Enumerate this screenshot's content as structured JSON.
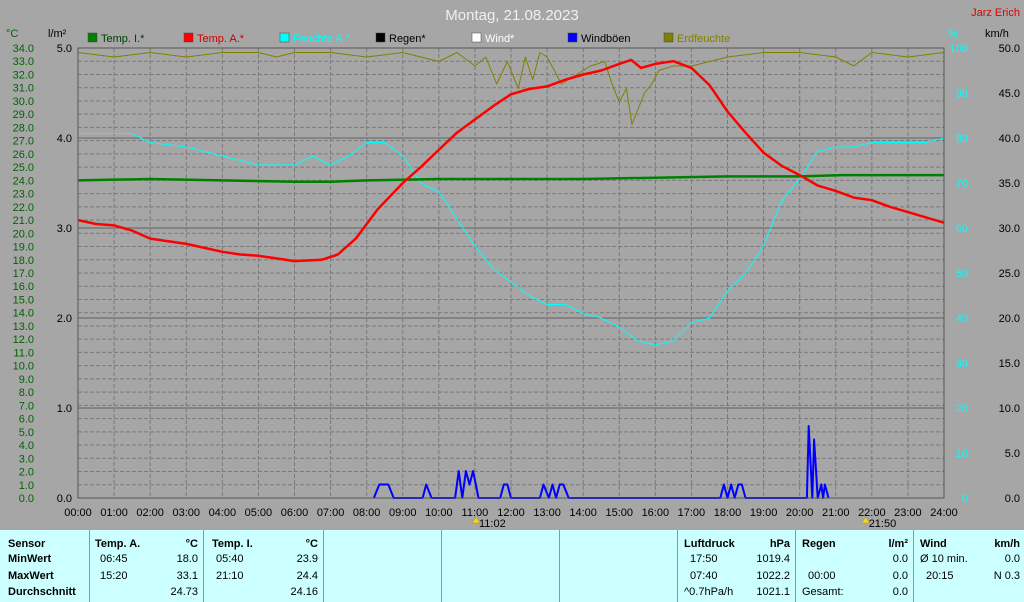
{
  "chart_data": {
    "type": "line",
    "title": "Montag, 21.08.2023",
    "author": "Jarz Erich",
    "x_ticks": [
      "00:00",
      "01:00",
      "02:00",
      "03:00",
      "04:00",
      "05:00",
      "06:00",
      "07:00",
      "08:00",
      "09:00",
      "10:00",
      "11:00",
      "12:00",
      "13:00",
      "14:00",
      "15:00",
      "16:00",
      "17:00",
      "18:00",
      "19:00",
      "20:00",
      "21:00",
      "22:00",
      "23:00",
      "24:00"
    ],
    "xlim": [
      0,
      24
    ],
    "axes": {
      "temp": {
        "unit": "°C",
        "lim": [
          0,
          34
        ],
        "ticks": [
          "0.0",
          "1.0",
          "2.0",
          "3.0",
          "4.0",
          "5.0",
          "6.0",
          "7.0",
          "8.0",
          "9.0",
          "10.0",
          "11.0",
          "12.0",
          "13.0",
          "14.0",
          "15.0",
          "16.0",
          "17.0",
          "18.0",
          "19.0",
          "20.0",
          "21.0",
          "22.0",
          "23.0",
          "24.0",
          "25.0",
          "26.0",
          "27.0",
          "28.0",
          "29.0",
          "30.0",
          "31.0",
          "32.0",
          "33.0",
          "34.0"
        ]
      },
      "rain": {
        "unit": "l/m²",
        "lim": [
          0,
          5
        ],
        "ticks": [
          "0.0",
          "1.0",
          "2.0",
          "3.0",
          "4.0",
          "5.0"
        ]
      },
      "humidity": {
        "unit": "%",
        "lim": [
          0,
          100
        ],
        "ticks": [
          "0",
          "10",
          "20",
          "30",
          "40",
          "50",
          "60",
          "70",
          "80",
          "90",
          "100"
        ]
      },
      "wind": {
        "unit": "km/h",
        "lim": [
          0,
          50
        ],
        "ticks": [
          "0.0",
          "5.0",
          "10.0",
          "15.0",
          "20.0",
          "25.0",
          "30.0",
          "35.0",
          "40.0",
          "45.0",
          "50.0"
        ]
      }
    },
    "legend": [
      {
        "name": "Temp. I.*",
        "color": "#008000"
      },
      {
        "name": "Temp. A.*",
        "color": "#ff0000"
      },
      {
        "name": "Feuchte A.*",
        "color": "#00ffff"
      },
      {
        "name": "Regen*",
        "color": "#000000"
      },
      {
        "name": "Wind*",
        "color": "#ffffff"
      },
      {
        "name": "Windböen",
        "color": "#0000ff"
      },
      {
        "name": "Erdfeuchte",
        "color": "#808000"
      }
    ],
    "series": [
      {
        "name": "Temp. I.*",
        "color": "#008000",
        "axis": "temp",
        "x": [
          0,
          2,
          4,
          6,
          7,
          8,
          10,
          12,
          14,
          16,
          18,
          20,
          21.17,
          22,
          24
        ],
        "y": [
          24.0,
          24.1,
          24.0,
          23.9,
          23.9,
          24.0,
          24.1,
          24.1,
          24.1,
          24.2,
          24.3,
          24.3,
          24.4,
          24.4,
          24.4
        ]
      },
      {
        "name": "Temp. A.*",
        "color": "#ff0000",
        "axis": "temp",
        "x": [
          0,
          0.5,
          1,
          1.5,
          2,
          3,
          4,
          4.5,
          5,
          5.5,
          6,
          6.75,
          7.2,
          7.7,
          8.3,
          9,
          9.5,
          10,
          10.5,
          11,
          11.5,
          12,
          12.5,
          13,
          13.5,
          14,
          14.5,
          15,
          15.33,
          15.6,
          16,
          16.5,
          17,
          17.5,
          18,
          18.5,
          19,
          19.5,
          20,
          20.5,
          21,
          21.5,
          22,
          22.5,
          23,
          23.5,
          24
        ],
        "y": [
          21.0,
          20.7,
          20.6,
          20.2,
          19.6,
          19.2,
          18.6,
          18.4,
          18.3,
          18.1,
          17.9,
          18.0,
          18.4,
          19.6,
          21.8,
          23.8,
          25.0,
          26.3,
          27.6,
          28.6,
          29.6,
          30.5,
          30.9,
          31.1,
          31.6,
          32.0,
          32.3,
          32.8,
          33.1,
          32.5,
          32.8,
          33.0,
          32.5,
          31.2,
          29.2,
          27.6,
          26.1,
          25.1,
          24.4,
          23.6,
          23.2,
          22.7,
          22.5,
          22.0,
          21.6,
          21.2,
          20.8
        ]
      },
      {
        "name": "Feuchte A.*",
        "color": "#00ffff",
        "axis": "humidity",
        "x": [
          0,
          1,
          1.5,
          2,
          3,
          4,
          5,
          6,
          6.5,
          7,
          7.5,
          8,
          8.5,
          9,
          9.5,
          10,
          10.5,
          11,
          11.5,
          12,
          12.5,
          13,
          13.5,
          14,
          14.5,
          15,
          15.5,
          16,
          16.5,
          17,
          17.5,
          18,
          18.5,
          19,
          19.5,
          20,
          20.5,
          21,
          21.5,
          22,
          22.5,
          23,
          23.5,
          24
        ],
        "y": [
          81,
          81,
          81,
          79,
          78,
          76,
          74,
          74,
          76,
          74,
          76,
          79,
          79,
          76,
          70,
          68,
          62,
          56,
          51,
          48,
          45,
          43,
          43,
          41,
          40,
          38,
          35,
          34,
          35,
          39,
          40,
          46,
          50,
          56,
          66,
          71,
          77,
          78,
          78,
          79,
          79,
          79,
          79,
          80
        ]
      },
      {
        "name": "Windböen",
        "color": "#0000ff",
        "axis": "wind",
        "x": [
          8.2,
          8.35,
          8.6,
          8.75,
          9.55,
          9.65,
          9.8,
          10.45,
          10.55,
          10.65,
          10.75,
          10.85,
          10.95,
          11.1,
          11.7,
          11.8,
          11.9,
          12.0,
          12.8,
          12.9,
          13.05,
          13.15,
          13.25,
          13.35,
          13.45,
          13.6,
          17.8,
          17.9,
          18.0,
          18.1,
          18.2,
          18.3,
          18.4,
          18.5,
          20.2,
          20.25,
          20.35,
          20.4,
          20.5,
          20.6,
          20.65,
          20.7,
          20.8
        ],
        "y": [
          0,
          1.5,
          1.5,
          0,
          0,
          1.5,
          0,
          0,
          3,
          0,
          3,
          1.5,
          3,
          0,
          0,
          1.5,
          1.5,
          0,
          0,
          1.5,
          0,
          1.5,
          0,
          1.5,
          1.5,
          0,
          0,
          1.5,
          0,
          1.5,
          0,
          1.5,
          1.5,
          0,
          0,
          8,
          0,
          6.5,
          0,
          1.5,
          0,
          1.5,
          0
        ]
      },
      {
        "name": "Erdfeuchte",
        "color": "#808000",
        "axis": "humidity",
        "x": [
          0,
          1,
          2,
          3,
          4,
          5,
          5.5,
          6,
          7,
          8,
          9,
          10,
          10.5,
          11,
          11.3,
          11.6,
          11.9,
          12.2,
          12.4,
          12.6,
          12.8,
          13,
          13.4,
          13.8,
          14.2,
          14.6,
          14.8,
          15,
          15.2,
          15.35,
          15.5,
          15.7,
          15.9,
          16.1,
          16.5,
          17,
          17.5,
          18,
          19,
          20,
          21,
          21.5,
          22,
          23,
          24
        ],
        "y": [
          99,
          98,
          99,
          98,
          99,
          99,
          98,
          99,
          99,
          98,
          99,
          97,
          99,
          96,
          98,
          92,
          97,
          91,
          98,
          93,
          99,
          98,
          92,
          94,
          96,
          97,
          92,
          88,
          91,
          83,
          86,
          90,
          92,
          95,
          96,
          96,
          97,
          98,
          99,
          99,
          98,
          96,
          99,
          98,
          99
        ]
      }
    ],
    "rain_series": [],
    "wind_series": [],
    "markers": [
      {
        "time": "11:02",
        "x": 11.03
      },
      {
        "time": "21:50",
        "x": 21.83
      }
    ],
    "grid": true
  },
  "table": {
    "sensor": {
      "head": "Sensor",
      "rows": [
        "MinWert",
        "MaxWert",
        "Durchschnitt"
      ]
    },
    "temp_a": {
      "head": "Temp. A.",
      "unit": "°C",
      "min_time": "06:45",
      "min": "18.0",
      "max_time": "15:20",
      "max": "33.1",
      "avg": "24.73"
    },
    "temp_i": {
      "head": "Temp. I.",
      "unit": "°C",
      "min_time": "05:40",
      "min": "23.9",
      "max_time": "21:10",
      "max": "24.4",
      "avg": "24.16"
    },
    "luftdruck": {
      "head": "Luftdruck",
      "unit": "hPa",
      "t1": "17:50",
      "v1": "1019.4",
      "t2": "07:40",
      "v2": "1022.2",
      "t3": "^0.7hPa/h",
      "v3": "1021.1"
    },
    "regen": {
      "head": "Regen",
      "unit": "l/m²",
      "t2": "00:00",
      "v2": "0.0",
      "t3": "Gesamt:",
      "v3": "0.0",
      "v1": "0.0"
    },
    "wind": {
      "head": "Wind",
      "unit": "km/h",
      "t1": "Ø 10 min.",
      "v1": "0.0",
      "t2": "20:15",
      "v2": "N 0.3"
    }
  }
}
